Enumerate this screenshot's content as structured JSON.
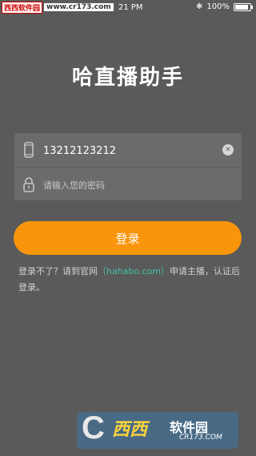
{
  "watermark_top": {
    "site_tag": "西西软件园",
    "url": "www.cr173.com"
  },
  "status_bar": {
    "time": "21 PM",
    "battery": "100%",
    "battery_level": 1.0
  },
  "app": {
    "title": "哈直播助手"
  },
  "form": {
    "phone_value": "13212123212",
    "password_placeholder": "请输入您的密码"
  },
  "login_button": {
    "label": "登录"
  },
  "hint": {
    "text_before": "登录不了？请到官网",
    "link": "（hahabo.com）",
    "text_after": "申请主播，认证后登录。"
  },
  "watermark_bottom": {
    "logo_letter": "C",
    "brand": "西西",
    "brand_suffix": "软件园",
    "url": "CR173.COM"
  },
  "colors": {
    "background": "#5a5a5a",
    "accent": "#f9950c",
    "link": "#3fc2a6"
  }
}
